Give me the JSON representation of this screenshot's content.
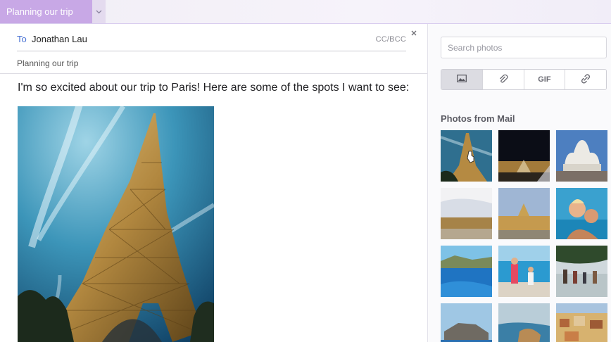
{
  "tab": {
    "title": "Planning our trip"
  },
  "compose": {
    "to_label": "To",
    "to_value": "Jonathan Lau",
    "cc_bcc": "CC/BCC",
    "subject": "Planning our trip",
    "body": "I'm so excited about our trip to Paris! Here are some of the spots I want to see:"
  },
  "sidebar": {
    "search_placeholder": "Search photos",
    "tools": [
      "photo-icon",
      "paperclip-icon",
      "GIF",
      "link-icon"
    ],
    "gif_label": "GIF",
    "section_title": "Photos from Mail"
  },
  "thumbnails": [
    "eiffel-tower",
    "louvre-night",
    "sacre-coeur",
    "versailles-gate",
    "versailles-palace",
    "couple-beach",
    "coastal-cove",
    "kids-beach",
    "family-shore",
    "cliff-sea",
    "rocky-bay",
    "hill-town"
  ],
  "colors": {
    "tab_bg": "#c8a8e6",
    "accent": "#4a73d4"
  }
}
